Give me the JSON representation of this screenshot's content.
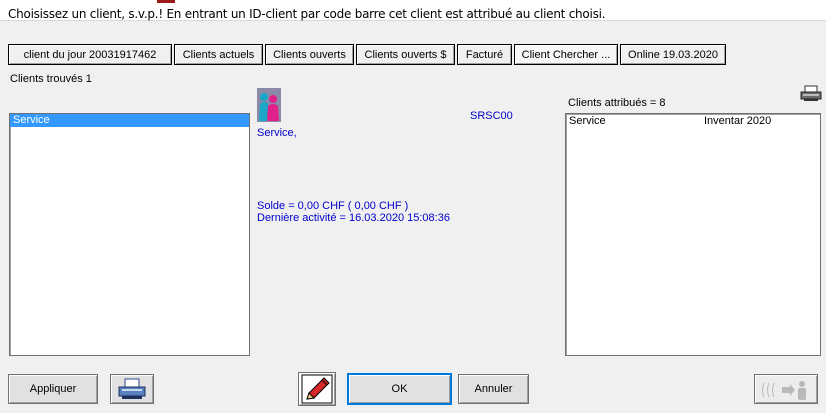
{
  "instruction": "Choisissez un client, s.v.p.! En entrant un ID-client par code barre cet client est attribué au client choisi.",
  "tabs": [
    {
      "label": "client du jour 20031917462"
    },
    {
      "label": "Clients actuels"
    },
    {
      "label": "Clients ouverts"
    },
    {
      "label": "Clients ouverts $"
    },
    {
      "label": "Facturé"
    },
    {
      "label": "Client Chercher ...",
      "active": true
    },
    {
      "label": "Online 19.03.2020"
    }
  ],
  "clients_found": "Clients trouvés 1",
  "client_list": [
    {
      "name": "Service",
      "selected": true
    }
  ],
  "details": {
    "name": "Service,",
    "code": "SRSC00",
    "balance": "Solde = 0,00 CHF ( 0,00 CHF )",
    "last_activity": "Dernière activité = 16.03.2020 15:08:36",
    "avatar_icon": "people-icon"
  },
  "assigned": {
    "label": "Clients attribués = 8",
    "rows": [
      {
        "name": "Service",
        "info": "Inventar 2020"
      }
    ]
  },
  "buttons": {
    "apply": "Appliquer",
    "ok": "OK",
    "cancel": "Annuler"
  },
  "colors": {
    "selection": "#3399ff",
    "detail_text": "#0000cc"
  }
}
